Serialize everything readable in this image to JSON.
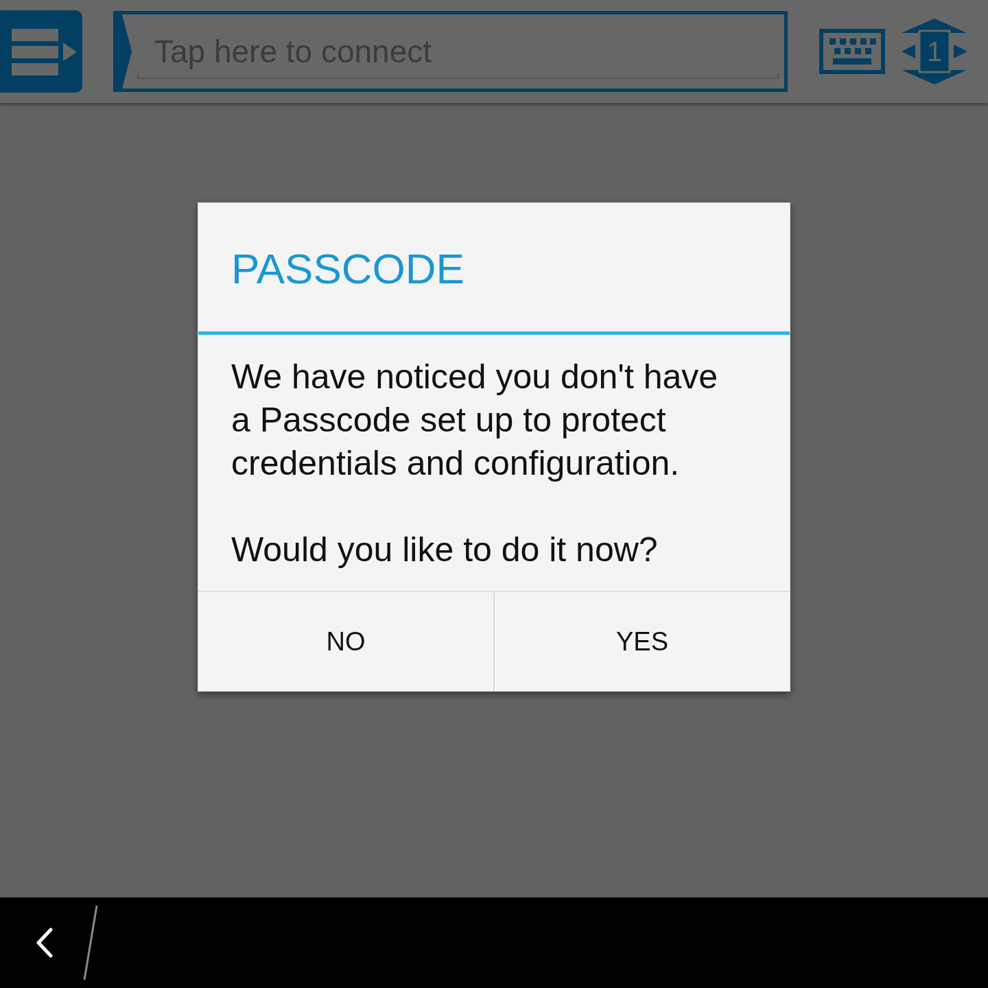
{
  "toolbar": {
    "connect_field": {
      "placeholder": "Tap here to connect"
    },
    "screen_badge": "1"
  },
  "dialog": {
    "title": "PASSCODE",
    "message": "We have noticed you don't have a Passcode set up to protect credentials and configuration.",
    "question": "Would you like to do it now?",
    "buttons": [
      "NO",
      "YES"
    ]
  }
}
